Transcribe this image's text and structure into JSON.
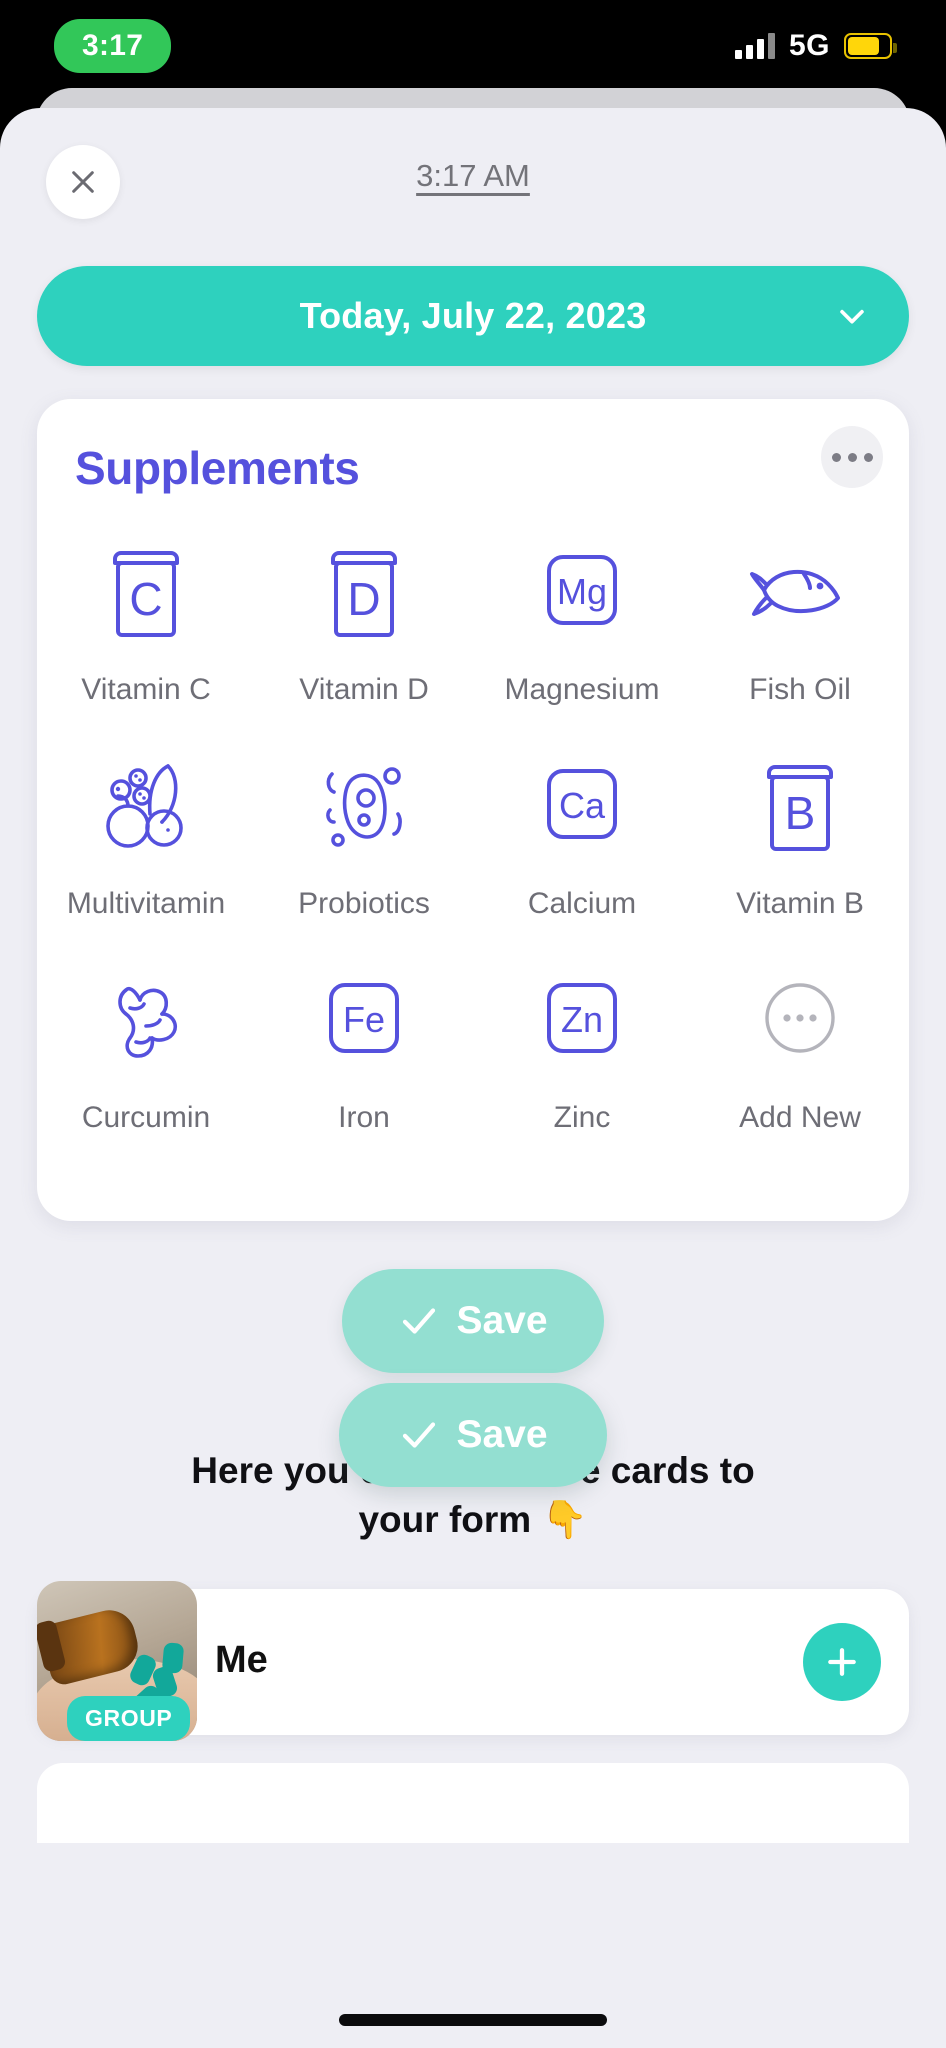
{
  "status_bar": {
    "time": "3:17",
    "network": "5G",
    "signal_icon": "cellular-bars-icon",
    "battery_icon": "battery-low-power-icon"
  },
  "sheet": {
    "close_icon": "close-icon",
    "timestamp": "3:17 AM"
  },
  "date_selector": {
    "label": "Today, July 22, 2023",
    "chevron_icon": "chevron-down-icon",
    "color": "#2ED1BE"
  },
  "supplements_card": {
    "title": "Supplements",
    "title_color": "#5551DD",
    "more_icon": "ellipsis-icon",
    "items": [
      {
        "label": "Vitamin C",
        "icon": "pill-bottle-c-icon",
        "symbol": "C"
      },
      {
        "label": "Vitamin D",
        "icon": "pill-bottle-d-icon",
        "symbol": "D"
      },
      {
        "label": "Magnesium",
        "icon": "element-mg-icon",
        "symbol": "Mg"
      },
      {
        "label": "Fish Oil",
        "icon": "fish-icon",
        "symbol": ""
      },
      {
        "label": "Multivitamin",
        "icon": "fruit-basket-icon",
        "symbol": ""
      },
      {
        "label": "Probiotics",
        "icon": "bacteria-icon",
        "symbol": ""
      },
      {
        "label": "Calcium",
        "icon": "element-ca-icon",
        "symbol": "Ca"
      },
      {
        "label": "Vitamin B",
        "icon": "pill-bottle-b-icon",
        "symbol": "B"
      },
      {
        "label": "Curcumin",
        "icon": "turmeric-root-icon",
        "symbol": ""
      },
      {
        "label": "Iron",
        "icon": "element-fe-icon",
        "symbol": "Fe"
      },
      {
        "label": "Zinc",
        "icon": "element-zn-icon",
        "symbol": "Zn"
      },
      {
        "label": "Add New",
        "icon": "add-new-ellipsis-icon",
        "symbol": ""
      }
    ]
  },
  "save_button": {
    "label": "Save",
    "check_icon": "check-icon",
    "color": "#93DFD1"
  },
  "hint": {
    "line1": "Here you can add more cards to",
    "line2": "your form 👇"
  },
  "bottom_card": {
    "title": "Me",
    "badge": "GROUP",
    "thumbnail_icon": "pill-bottle-photo",
    "add_icon": "plus-icon",
    "add_color": "#2ED1BE"
  },
  "save_overlay": {
    "label": "Save",
    "check_icon": "check-icon"
  }
}
